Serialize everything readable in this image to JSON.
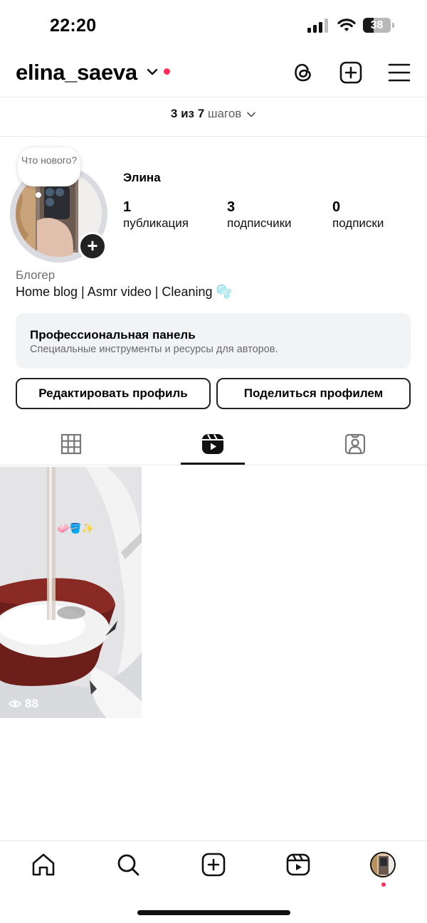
{
  "status_bar": {
    "time": "22:20",
    "battery": "38",
    "battery_level": 0.38
  },
  "header": {
    "username": "elina_saeva"
  },
  "steps": {
    "current": "3 из 7",
    "rest": "шагов"
  },
  "profile": {
    "story_prompt": "Что нового?",
    "display_name": "Элина",
    "stats": [
      {
        "value": "1",
        "label": "публикация"
      },
      {
        "value": "3",
        "label": "подписчики"
      },
      {
        "value": "0",
        "label": "подписки"
      }
    ],
    "category": "Блогер",
    "bio": "Home blog | Asmr video | Cleaning 🫧"
  },
  "pro_panel": {
    "title": "Профессиональная панель",
    "subtitle": "Специальные инструменты и ресурсы для авторов."
  },
  "buttons": {
    "edit": "Редактировать профиль",
    "share": "Поделиться профилем"
  },
  "tabs": {
    "active": "reels"
  },
  "reels": [
    {
      "views": "88",
      "sticker": "🧼🪣✨"
    }
  ],
  "colors": {
    "notification": "#ff2d55",
    "panel_bg": "#f2f3f5"
  }
}
